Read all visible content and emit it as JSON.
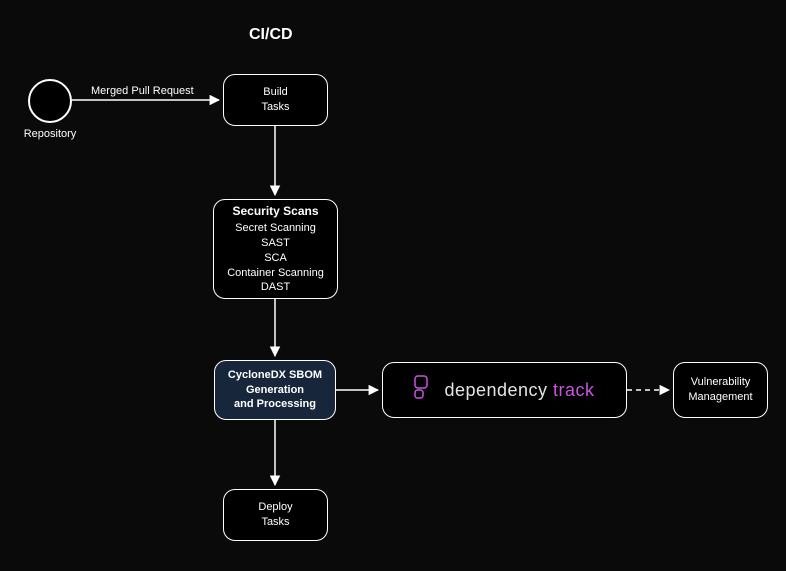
{
  "title": "CI/CD",
  "repo": {
    "label": "Repository"
  },
  "edge_labels": {
    "merged_pr": "Merged Pull Request"
  },
  "nodes": {
    "build": {
      "line1": "Build",
      "line2": "Tasks"
    },
    "security": {
      "heading": "Security Scans",
      "l1": "Secret Scanning",
      "l2": "SAST",
      "l3": "SCA",
      "l4": "Container Scanning",
      "l5": "DAST"
    },
    "sbom": {
      "l1": "CycloneDX SBOM",
      "l2": "Generation",
      "l3": "and Processing"
    },
    "deploy": {
      "line1": "Deploy",
      "line2": "Tasks"
    },
    "deptrack": {
      "word1": "dependency",
      "word2": "track"
    },
    "vuln": {
      "l1": "Vulnerability",
      "l2": "Management"
    }
  }
}
